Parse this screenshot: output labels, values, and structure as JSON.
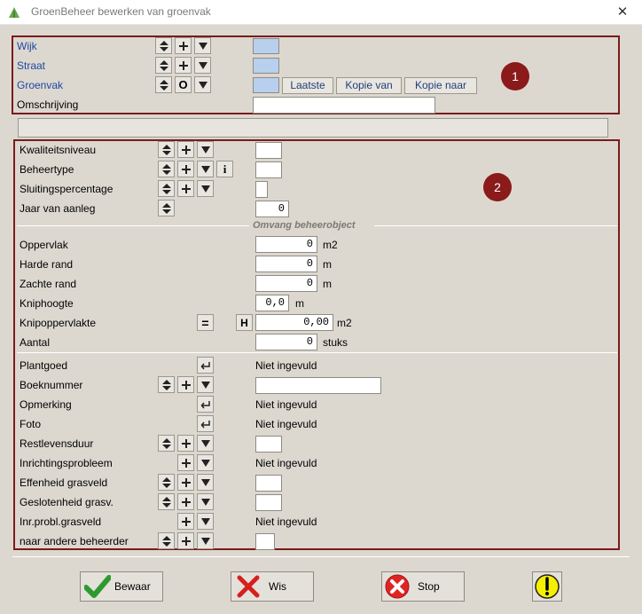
{
  "window": {
    "title": "GroenBeheer  bewerken van groenvak",
    "close": "✕"
  },
  "header_section": {
    "badge": "1",
    "rows": [
      {
        "label": "Wijk",
        "field_value": ""
      },
      {
        "label": "Straat",
        "field_value": ""
      },
      {
        "label": "Groenvak",
        "field_value": ""
      },
      {
        "label": "Omschrijving",
        "field_value": ""
      }
    ],
    "buttons": {
      "laatste": "Laatste",
      "kopie_van": "Kopie van",
      "kopie_naar": "Kopie naar"
    },
    "o_label": "O"
  },
  "detail_section": {
    "badge": "2",
    "rows": [
      {
        "label": "Kwaliteitsniveau",
        "value": ""
      },
      {
        "label": "Beheertype",
        "value": ""
      },
      {
        "label": "Sluitingspercentage",
        "value": ""
      },
      {
        "label": "Jaar van aanleg",
        "value": "0"
      }
    ],
    "info_label": "i",
    "omvang_title": "Omvang beheerobject",
    "omvang_rows": [
      {
        "label": "Oppervlak",
        "value": "0",
        "unit": "m2"
      },
      {
        "label": "Harde rand",
        "value": "0",
        "unit": "m"
      },
      {
        "label": "Zachte rand",
        "value": "0",
        "unit": "m"
      },
      {
        "label": "Kniphoogte",
        "value": "0,0",
        "unit": "m"
      },
      {
        "label": "Knipoppervlakte",
        "value": "0,00",
        "unit": "m2"
      },
      {
        "label": "Aantal",
        "value": "0",
        "unit": "stuks"
      }
    ],
    "eq_label": "=",
    "h_label": "H",
    "extra_rows": [
      {
        "label": "Plantgoed",
        "value": "Niet ingevuld"
      },
      {
        "label": "Boeknummer",
        "value": ""
      },
      {
        "label": "Opmerking",
        "value": "Niet ingevuld"
      },
      {
        "label": "Foto",
        "value": "Niet ingevuld"
      },
      {
        "label": "Restlevensduur",
        "value": ""
      },
      {
        "label": "Inrichtingsprobleem",
        "value": "Niet ingevuld"
      },
      {
        "label": "Effenheid grasveld",
        "value": ""
      },
      {
        "label": "Geslotenheid grasv.",
        "value": ""
      },
      {
        "label": "Inr.probl.grasveld",
        "value": "Niet ingevuld"
      },
      {
        "label": "naar andere beheerder",
        "value": ""
      }
    ]
  },
  "footer": {
    "bewaar": "Bewaar",
    "wis": "Wis",
    "stop": "Stop"
  },
  "colors": {
    "accent_border": "#7a1b1b",
    "badge": "#8b1a1a",
    "code_field": "#b9cfee",
    "label_blue": "#1f47a3"
  }
}
